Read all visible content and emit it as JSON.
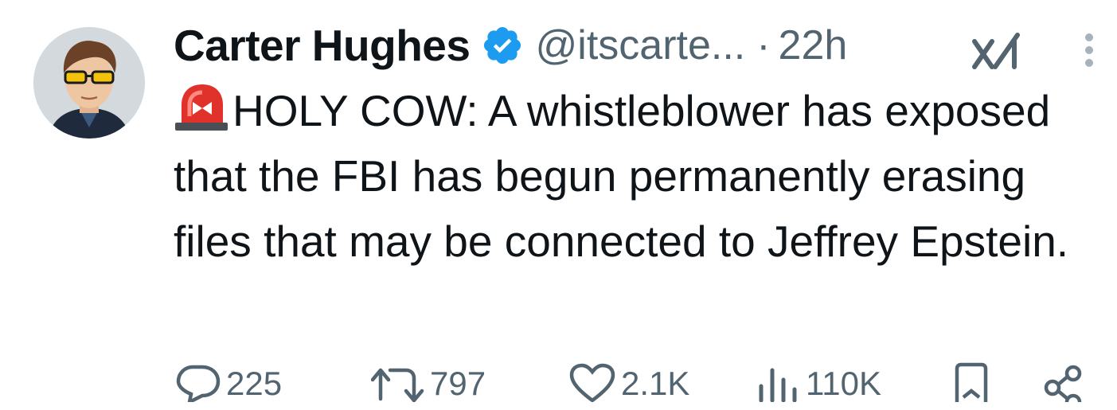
{
  "tweet": {
    "author": {
      "display_name": "Carter Hughes",
      "handle": "@itscarte...",
      "verified": true
    },
    "separator": "·",
    "timestamp": "22h",
    "emoji": "siren",
    "text": "HOLY COW: A whistleblower has exposed that the FBI has begun permanently erasing files that may be connected to Jeffrey Epstein.",
    "metrics": {
      "replies": "225",
      "reposts": "797",
      "likes": "2.1K",
      "views": "110K"
    }
  },
  "icons": {
    "verified": "verified-badge-icon",
    "grok": "grok-icon",
    "more": "more-options-icon",
    "reply": "reply-icon",
    "repost": "repost-icon",
    "like": "like-icon",
    "views": "views-icon",
    "bookmark": "bookmark-icon",
    "share": "share-icon"
  },
  "colors": {
    "text_primary": "#0f1419",
    "text_secondary": "#536471",
    "verified_blue": "#1d9bf0",
    "siren_red": "#e0312b"
  }
}
